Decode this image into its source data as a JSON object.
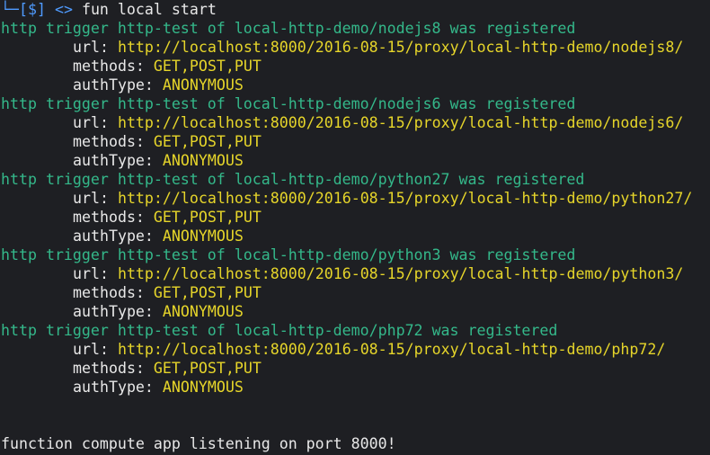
{
  "prompt": {
    "corner": "└─",
    "symbol": "[$]",
    "arrow": "<>",
    "command": "fun local start"
  },
  "triggers": [
    {
      "message": "http trigger http-test of local-http-demo/nodejs8 was registered",
      "url_label": "url: ",
      "url": "http://localhost:8000/2016-08-15/proxy/local-http-demo/nodejs8/",
      "methods_label": "methods: ",
      "methods": "GET,POST,PUT",
      "auth_label": "authType: ",
      "auth": "ANONYMOUS"
    },
    {
      "message": "http trigger http-test of local-http-demo/nodejs6 was registered",
      "url_label": "url: ",
      "url": "http://localhost:8000/2016-08-15/proxy/local-http-demo/nodejs6/",
      "methods_label": "methods: ",
      "methods": "GET,POST,PUT",
      "auth_label": "authType: ",
      "auth": "ANONYMOUS"
    },
    {
      "message": "http trigger http-test of local-http-demo/python27 was registered",
      "url_label": "url: ",
      "url": "http://localhost:8000/2016-08-15/proxy/local-http-demo/python27/",
      "methods_label": "methods: ",
      "methods": "GET,POST,PUT",
      "auth_label": "authType: ",
      "auth": "ANONYMOUS"
    },
    {
      "message": "http trigger http-test of local-http-demo/python3 was registered",
      "url_label": "url: ",
      "url": "http://localhost:8000/2016-08-15/proxy/local-http-demo/python3/",
      "methods_label": "methods: ",
      "methods": "GET,POST,PUT",
      "auth_label": "authType: ",
      "auth": "ANONYMOUS"
    },
    {
      "message": "http trigger http-test of local-http-demo/php72 was registered",
      "url_label": "url: ",
      "url": "http://localhost:8000/2016-08-15/proxy/local-http-demo/php72/",
      "methods_label": "methods: ",
      "methods": "GET,POST,PUT",
      "auth_label": "authType: ",
      "auth": "ANONYMOUS"
    }
  ],
  "footer": "function compute app listening on port 8000!",
  "colors": {
    "background": "#1e1f23",
    "prompt": "#4f9bff",
    "message": "#34b88a",
    "value": "#e6d52a",
    "text": "#e8e8e8"
  }
}
